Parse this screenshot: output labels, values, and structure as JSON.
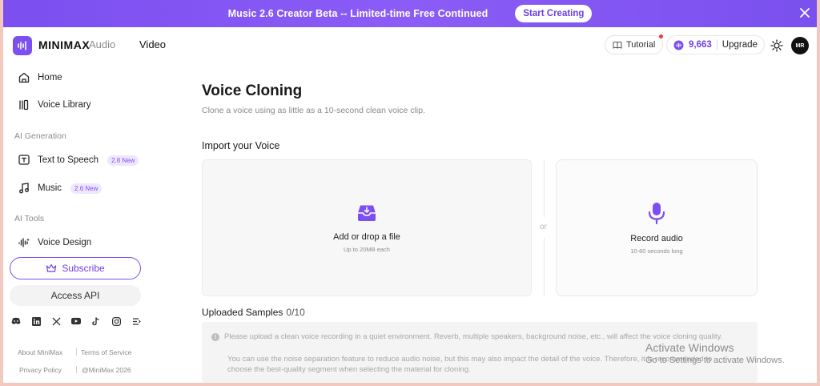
{
  "banner": {
    "text": "Music 2.6 Creator Beta -- Limited-time Free Continued",
    "cta": "Start Creating"
  },
  "topnav": {
    "brand": "MINIMAX",
    "product": "Audio",
    "video": "Video",
    "tutorial": "Tutorial",
    "credits": "9,663",
    "upgrade": "Upgrade",
    "avatar": "MR"
  },
  "sidebar": {
    "home": "Home",
    "voice_library": "Voice Library",
    "section_generation": "AI Generation",
    "text_to_speech": "Text to Speech",
    "tts_tag": "2.8 New",
    "music": "Music",
    "music_tag": "2.6 New",
    "section_tools": "AI Tools",
    "voice_design": "Voice Design",
    "subscribe": "Subscribe",
    "access_api": "Access API",
    "footer": {
      "about": "About MiniMax",
      "terms": "Terms of Service",
      "privacy": "Privacy Policy",
      "copyright": "@MiniMax 2026"
    }
  },
  "main": {
    "title": "Voice Cloning",
    "subtitle": "Clone a voice using as little as a 10-second clean voice clip.",
    "import_title": "Import your Voice",
    "upload": {
      "title": "Add or drop a file",
      "sub": "Up to 20MB each"
    },
    "or": "or",
    "record": {
      "title": "Record audio",
      "sub": "10-60 seconds long"
    },
    "samples_title": "Uploaded Samples",
    "samples_count": "0/10",
    "notice_1": "Please upload a clean voice recording in a quiet environment. Reverb, multiple speakers, background noise, etc., will affect the voice cloning quality.",
    "notice_2a": "You can use the noise separation feature to reduce audio noise, but this may also impact the detail of the voice. Therefore, it is recommended to",
    "notice_2b": "choose the best-quality segment when selecting the material for cloning."
  },
  "watermark": {
    "title": "Activate Windows",
    "sub": "Go to Settings to activate Windows."
  },
  "colors": {
    "accent": "#7b4ff0",
    "banner": "#8b5cf6"
  }
}
